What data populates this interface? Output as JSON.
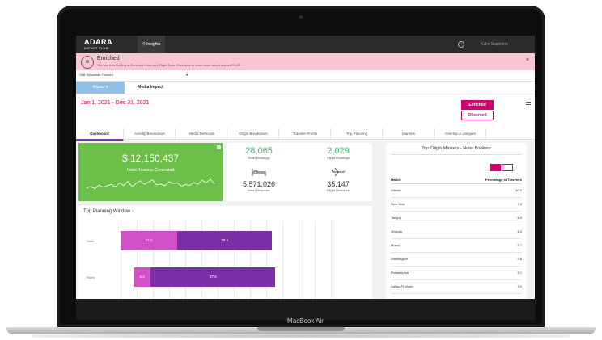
{
  "device": {
    "label": "MacBook Air"
  },
  "topbar": {
    "logo": "ADARA",
    "logo_sub": "IMPACT PLUS",
    "section": "Insights",
    "info_glyph": "i",
    "user": "Katie Stapleton"
  },
  "banner": {
    "title": "Enriched",
    "text": "You are now looking at Enriched Hotel and Flight Data. Click here to learn more about Impact PLUS",
    "close": "×"
  },
  "account_select": {
    "value": "Visit Savannah Tourism"
  },
  "main_tabs": {
    "impact": "Impact",
    "media": "Media Impact"
  },
  "date_range": "Jan 1, 2021 - Dec 31, 2021",
  "data_toggle": {
    "enriched": "Enriched",
    "observed": "Observed"
  },
  "nav_tabs": [
    {
      "label": "Dashboard"
    },
    {
      "label": "Activity Breakdown"
    },
    {
      "label": "Media Referrals"
    },
    {
      "label": "Origin Breakdown"
    },
    {
      "label": "Traveler Profile"
    },
    {
      "label": "Trip Planning"
    },
    {
      "label": "Markets"
    },
    {
      "label": "Overlap & Uniques"
    }
  ],
  "revenue": {
    "amount": "$ 12,150,437",
    "label": "Hotel Revenue Generated",
    "sparkline": [
      0.35,
      0.45,
      0.3,
      0.55,
      0.4,
      0.5,
      0.6,
      0.42,
      0.7,
      0.52,
      0.8,
      0.45,
      0.66,
      0.85,
      0.6,
      0.75,
      0.9,
      0.55,
      0.62,
      0.5,
      0.78,
      0.65,
      0.7,
      0.48,
      0.58,
      0.52,
      0.72,
      0.6,
      0.88,
      0.7,
      0.95,
      0.62
    ]
  },
  "bookings": {
    "hotel_bookings": "28,065",
    "hotel_bookings_label": "Hotel Bookings",
    "flight_bookings": "2,029",
    "flight_bookings_label": "Flight Bookings",
    "hotel_searches": "5,571,026",
    "hotel_searches_label": "Hotel Searches",
    "flight_searches": "35,147",
    "flight_searches_label": "Flight Searches",
    "hotel_icon": "bed-icon",
    "flight_icon": "plane-icon"
  },
  "markets": {
    "title": "Top Origin Markets - Hotel Bookers",
    "col_market": "Market",
    "col_pct": "Percentage of Travelers",
    "rows": [
      {
        "market": "Atlanta",
        "pct": "10.0"
      },
      {
        "market": "New York",
        "pct": "7.0"
      },
      {
        "market": "Tampa",
        "pct": "6.5"
      },
      {
        "market": "Orlando",
        "pct": "6.3"
      },
      {
        "market": "Miami",
        "pct": "5.7"
      },
      {
        "market": "Washington",
        "pct": "5.6"
      },
      {
        "market": "Philadelphia",
        "pct": "5.1"
      },
      {
        "market": "Dallas-Ft Worth",
        "pct": "3.0"
      }
    ]
  },
  "trip_planning": {
    "title": "Trip Planning Window",
    "rows": [
      {
        "label": "Hotel",
        "segments": [
          {
            "value": "17.1",
            "color": "#d24fc5"
          },
          {
            "value": "28.6",
            "color": "#7b30a8"
          }
        ]
      },
      {
        "label": "Flight",
        "segments": [
          {
            "value": "5.2",
            "color": "#d24fc5"
          },
          {
            "value": "37.6",
            "color": "#7b30a8"
          }
        ]
      }
    ]
  },
  "colors": {
    "accent": "#d4006e",
    "green": "#6cc04a",
    "purple": "#7b30a8",
    "pink": "#d24fc5"
  }
}
